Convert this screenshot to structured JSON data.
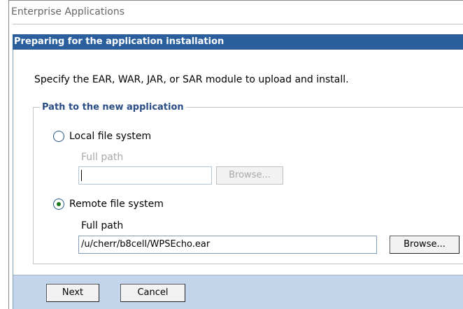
{
  "app_title": "Enterprise Applications",
  "wizard": {
    "header": "Preparing for the application installation",
    "instructions": "Specify the EAR, WAR, JAR, or SAR module to upload and install."
  },
  "path_group": {
    "legend": "Path to the new application",
    "local": {
      "label": "Local file system",
      "selected": false,
      "path_label": "Full path",
      "path_value": "",
      "browse_label": "Browse...",
      "enabled": false
    },
    "remote": {
      "label": "Remote file system",
      "selected": true,
      "path_label": "Full path",
      "path_value": "/u/cherr/b8cell/WPSEcho.ear",
      "browse_label": "Browse...",
      "enabled": true
    }
  },
  "footer": {
    "next_label": "Next",
    "cancel_label": "Cancel"
  },
  "colors": {
    "header_bg": "#2a5e9c",
    "legend_text": "#2a4d85",
    "footer_bg": "#c2d5ea",
    "radio_selected_dot": "#1f7a1f"
  }
}
